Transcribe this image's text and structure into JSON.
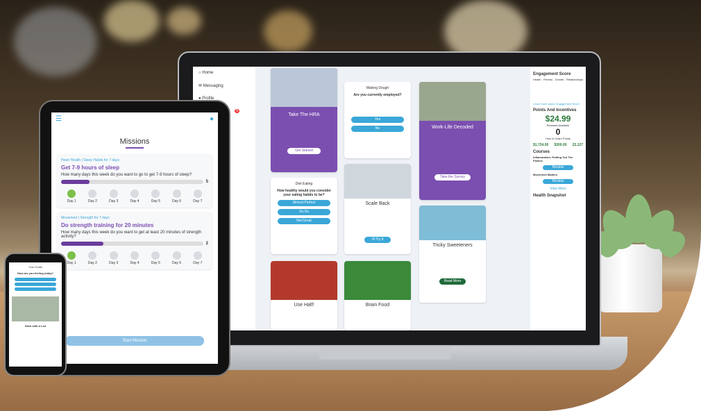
{
  "laptop": {
    "nav": [
      "Home",
      "Messaging",
      "Profile"
    ],
    "badge": "5",
    "cards": {
      "hra_title": "Take The HRA",
      "hra_button": "Get Started",
      "employed_label": "Making Dough",
      "employed_question": "Are you currently employed?",
      "employed_options": [
        "Yes",
        "No"
      ],
      "diet_label": "Diet Eating",
      "diet_question": "How healthy would you consider your eating habits to be?",
      "diet_options": [
        "Almost Perfect",
        "So-So",
        "Not Great"
      ],
      "scale_title": "Scale Back",
      "scale_button": "I'll Try It",
      "worklife_title": "Work-Life Decoded",
      "worklife_button": "Take the Survey",
      "sweet_title": "Tricky Sweeteners",
      "sweet_button": "Read More",
      "use_half_title": "Use Half!",
      "brain_title": "Brain Food"
    },
    "right": {
      "engagement_title": "Engagement Score",
      "engagement_icons": [
        "Health",
        "Fitness",
        "Growth",
        "Relationships"
      ],
      "engagement_link": "Learn more about Engagement Score",
      "points_title": "Points And Incentives",
      "rewards_amount": "$24.99",
      "rewards_label": "Rewards Available",
      "todo_count": "0",
      "todo_label": "How to Claim Points",
      "stats": [
        "$1,724.00",
        "$300.00",
        "22,127"
      ],
      "courses_title": "Courses",
      "course1": "Inflammation: Putting Out The Flames",
      "course2": "Movement Matters",
      "review": "Review",
      "view_more": "View More",
      "snapshot_title": "Health Snapshot"
    }
  },
  "tablet": {
    "title": "Missions",
    "m1_tag": "Heart Health | Sleep Habits for 7 days",
    "m1_title": "Get 7-9 hours of sleep",
    "m1_question": "How many days this week do you want to go to get 7-9 hours of sleep?",
    "m1_fill": "1 Day",
    "m1_value": "5",
    "m2_tag": "Movement | Strength for 7 days",
    "m2_title": "Do strength training for 20 minutes",
    "m2_question": "How many days this week do you want to get at least 20 minutes of strength activity?",
    "m2_fill": "1 Day",
    "m2_value": "2",
    "days": [
      "Day 1",
      "Day 2",
      "Day 3",
      "Day 4",
      "Day 5",
      "Day 6",
      "Day 7"
    ],
    "start": "Start Mission"
  },
  "phone": {
    "top": "Your Goals",
    "question": "How are you feeling today?",
    "title": "Stick with a List"
  },
  "colors": {
    "purple": "#7b4fb0",
    "blue": "#3aa7d8",
    "green": "#2c7a3b"
  }
}
